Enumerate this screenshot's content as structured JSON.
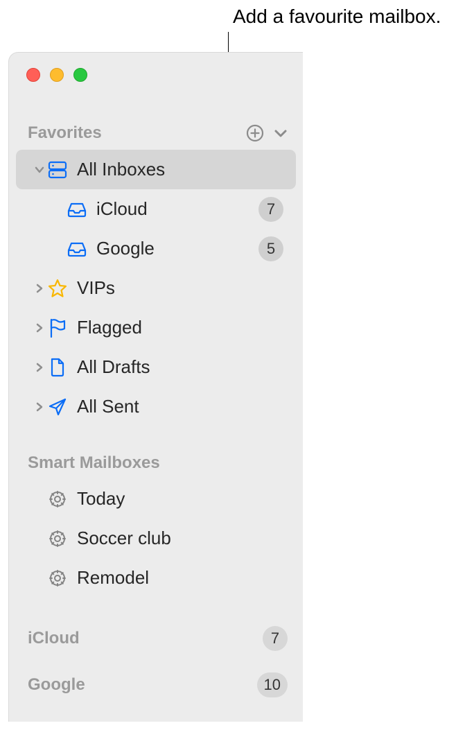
{
  "callout": {
    "text": "Add a favourite mailbox."
  },
  "sidebar": {
    "favorites": {
      "header": "Favorites",
      "items": [
        {
          "label": "All Inboxes",
          "icon": "mailboxes-icon",
          "selected": true,
          "expandable": true,
          "expanded": true,
          "children": [
            {
              "label": "iCloud",
              "icon": "inbox-icon",
              "badge": "7"
            },
            {
              "label": "Google",
              "icon": "inbox-icon",
              "badge": "5"
            }
          ]
        },
        {
          "label": "VIPs",
          "icon": "star-icon",
          "expandable": true,
          "expanded": false,
          "iconColor": "#f9b700"
        },
        {
          "label": "Flagged",
          "icon": "flag-icon",
          "expandable": true,
          "expanded": false
        },
        {
          "label": "All Drafts",
          "icon": "doc-icon",
          "expandable": true,
          "expanded": false
        },
        {
          "label": "All Sent",
          "icon": "paperplane-icon",
          "expandable": true,
          "expanded": false
        }
      ]
    },
    "smart_mailboxes": {
      "header": "Smart Mailboxes",
      "items": [
        {
          "label": "Today",
          "icon": "gear-icon"
        },
        {
          "label": "Soccer club",
          "icon": "gear-icon"
        },
        {
          "label": "Remodel",
          "icon": "gear-icon"
        }
      ]
    },
    "accounts": [
      {
        "label": "iCloud",
        "badge": "7"
      },
      {
        "label": "Google",
        "badge": "10"
      }
    ]
  }
}
